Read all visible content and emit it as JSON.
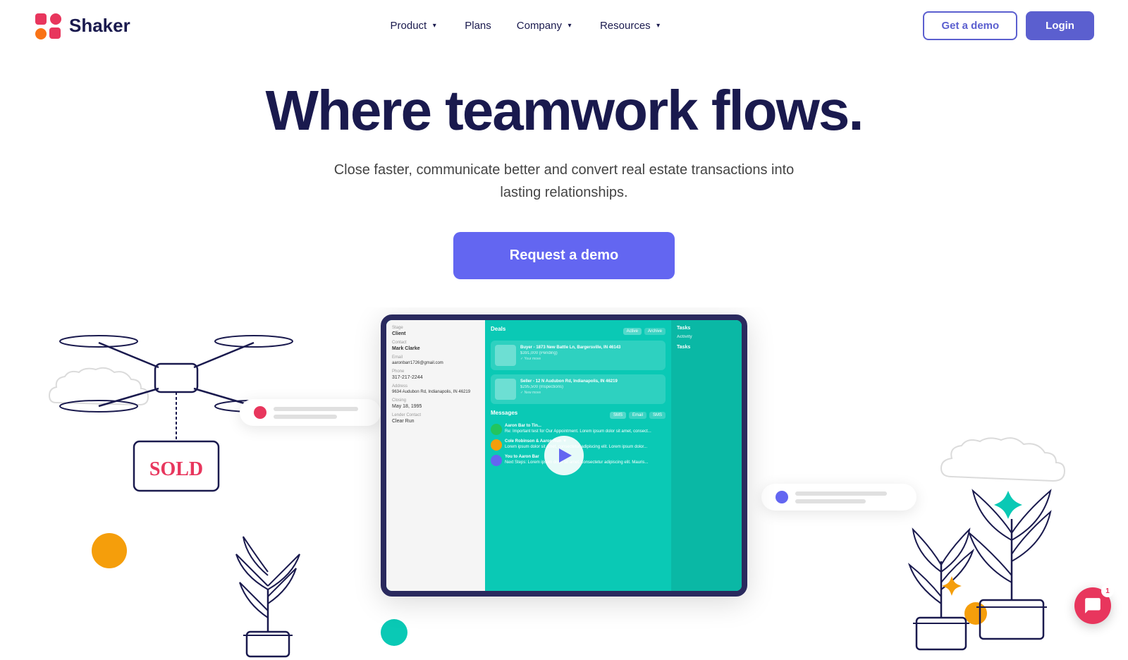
{
  "brand": {
    "name": "Shaker",
    "logo_alt": "Shaker logo"
  },
  "nav": {
    "product_label": "Product",
    "plans_label": "Plans",
    "company_label": "Company",
    "resources_label": "Resources",
    "get_demo_label": "Get a demo",
    "login_label": "Login"
  },
  "hero": {
    "title": "Where teamwork flows.",
    "subtitle": "Close faster, communicate better and convert real estate transactions into lasting relationships.",
    "cta_label": "Request a demo"
  },
  "screen": {
    "section_deals": "Deals",
    "deal1_address": "1873 New Battle Ln, Bargersville, IN 46143",
    "deal1_price": "$391,000 (Pending)",
    "deal2_address": "12 N Audubon Rd, Indianapolis, IN 46219",
    "deal2_price": "$295,500 (Inspections)",
    "section_messages": "Messages",
    "msg1_name": "Aaron Bar",
    "msg1_text": "Re: Important test for Our Appointment. Lorem ipsum dolor sit amet, consect...",
    "msg2_name": "Cole Robinson & Aaron Bar",
    "msg2_text": "Lorem ipsum dolor sit amet, consectetur adipiscing elit. Lorem ipsum dolor...",
    "msg3_name": "You to Aaron Bar",
    "msg3_text": "Next Steps: Lorem ipsum dolor sit amet, consectetur adipiscing elit. Mauris...",
    "section_tasks": "Tasks",
    "section_activity": "Activity"
  },
  "chat": {
    "badge_count": "1"
  },
  "shapes": {
    "green_pentagon": "green",
    "pink_pentagon": "#e8365d",
    "orange_circle": "#f59e0b",
    "teal_circle": "#0ac9b5",
    "yellow_small": "#f59e0b"
  }
}
